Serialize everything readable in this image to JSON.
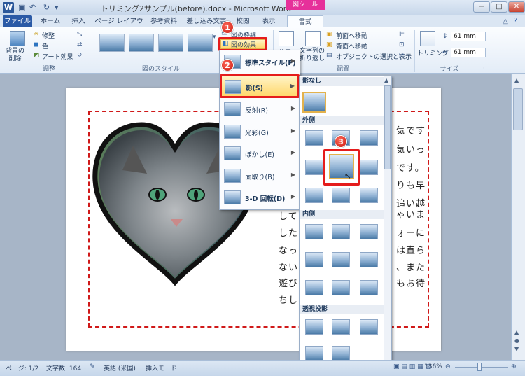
{
  "window": {
    "title": "トリミング2サンプル(before).docx - Microsoft Word",
    "app_icon": "W",
    "context_tab": "図ツール",
    "controls": [
      "−",
      "□",
      "✕"
    ]
  },
  "tabs": [
    "ファイル",
    "ホーム",
    "挿入",
    "ページ レイアウト",
    "参考資料",
    "差し込み文書",
    "校閲",
    "表示",
    "書式"
  ],
  "ribbon": {
    "remove_bg": "背景の\n削除",
    "adjust": {
      "corrections": "修整",
      "color": "色",
      "artistic": "アート効果",
      "label": "調整"
    },
    "styles_label": "図のスタイル",
    "picture_border": "図の枠線",
    "picture_effects": "図の効果",
    "position": "位置",
    "wrap_text": "文字列の\n折り返し",
    "bring_forward": "前面へ移動",
    "send_backward": "背面へ移動",
    "selection_pane": "オブジェクトの選択と表示",
    "arrange_label": "配置",
    "crop": "トリミング",
    "height": "61 mm",
    "width": "61 mm",
    "size_label": "サイズ"
  },
  "menu": {
    "items": [
      {
        "label": "標準スタイル(P)",
        "bold": true
      },
      {
        "label": "影(S)",
        "bold": true
      },
      {
        "label": "反射(R)",
        "bold": false
      },
      {
        "label": "光彩(G)",
        "bold": false
      },
      {
        "label": "ぼかし(E)",
        "bold": false
      },
      {
        "label": "面取り(B)",
        "bold": false
      },
      {
        "label": "3-D 回転(D)",
        "bold": false
      }
    ]
  },
  "gallery": {
    "sections": [
      "影なし",
      "外側",
      "内側",
      "透視投影"
    ]
  },
  "badges": [
    "1",
    "2",
    "3"
  ],
  "document": {
    "lines": [
      "気です",
      "気いっ",
      "です。",
      "りも早",
      "追い越",
      "ゃいま",
      "ォーに",
      "は直ら",
      "、また",
      "もお待"
    ],
    "left_lines": [
      "して",
      "した",
      "なっ",
      "ない",
      "遊び",
      "ちし"
    ]
  },
  "status": {
    "page": "ページ: 1/2",
    "words": "文字数: 164",
    "lang": "英語 (米国)",
    "mode": "挿入モード",
    "zoom": "136%"
  },
  "colors": {
    "accent": "#2b5aa6",
    "highlight": "#e51c1c",
    "context": "#e6309a"
  }
}
